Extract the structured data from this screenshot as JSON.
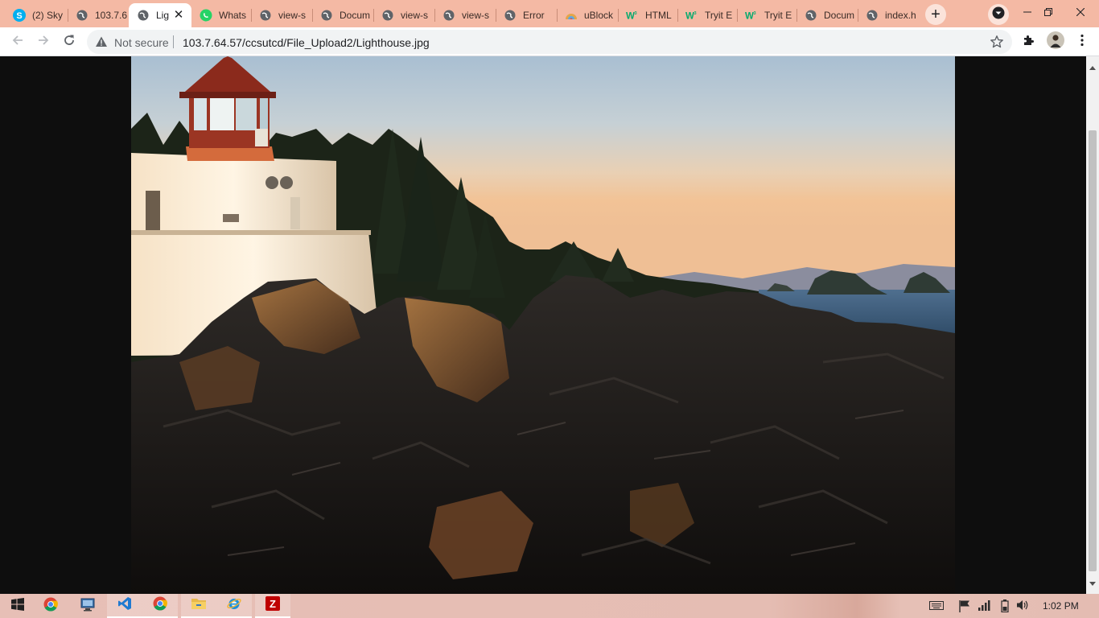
{
  "browser": {
    "tabs": [
      {
        "title": "(2) Sky",
        "icon": "skype-icon"
      },
      {
        "title": "103.7.6",
        "icon": "globe-icon"
      },
      {
        "title": "Lig",
        "icon": "globe-icon",
        "active": true
      },
      {
        "title": "Whats",
        "icon": "whatsapp-icon"
      },
      {
        "title": "view-s",
        "icon": "globe-icon"
      },
      {
        "title": "Docum",
        "icon": "globe-icon"
      },
      {
        "title": "view-s",
        "icon": "globe-icon"
      },
      {
        "title": "view-s",
        "icon": "globe-icon"
      },
      {
        "title": "Error",
        "icon": "globe-icon"
      },
      {
        "title": "uBlock",
        "icon": "ublock-icon"
      },
      {
        "title": "HTML",
        "icon": "w3schools-icon"
      },
      {
        "title": "Tryit E",
        "icon": "w3schools-icon"
      },
      {
        "title": "Tryit E",
        "icon": "w3schools-icon"
      },
      {
        "title": "Docum",
        "icon": "globe-icon"
      },
      {
        "title": "index.h",
        "icon": "globe-icon"
      }
    ],
    "security_label": "Not secure",
    "url": "103.7.64.57/ccsutcd/File_Upload2/Lighthouse.jpg"
  },
  "content": {
    "image": "Lighthouse.jpg",
    "image_subject": "lighthouse-on-rocks-at-sunset"
  },
  "taskbar": {
    "clock": "1:02 PM",
    "apps": [
      "chrome-icon",
      "network-app-icon",
      "vscode-icon",
      "chrome-icon",
      "file-explorer-icon",
      "internet-explorer-icon",
      "filezilla-icon"
    ]
  },
  "colors": {
    "tabstrip": "#f4b9a4",
    "page_background": "#0e0e0e",
    "taskbar": "#e6bfb5"
  }
}
